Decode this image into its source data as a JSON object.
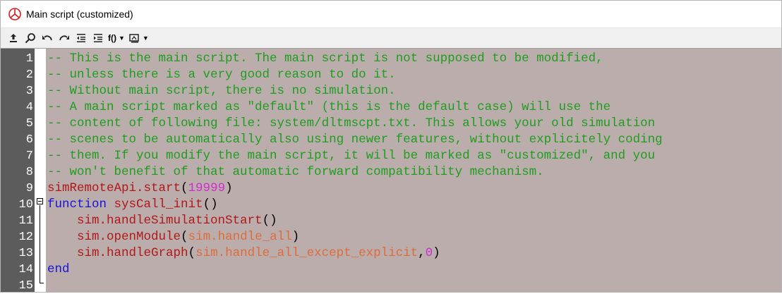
{
  "window": {
    "title": "Main script (customized)"
  },
  "toolbar": {
    "func_label": "f()"
  },
  "colors": {
    "editor_bg": "#bcadad",
    "gutter_bg": "#5c5c5c",
    "comment": "#1f9d1f",
    "function": "#b01818",
    "keyword": "#1515d6",
    "number": "#d12bd1",
    "constant": "#de6b3a"
  },
  "editor": {
    "line_numbers": [
      "1",
      "2",
      "3",
      "4",
      "5",
      "6",
      "7",
      "8",
      "9",
      "10",
      "11",
      "12",
      "13",
      "14",
      "15"
    ],
    "lines": [
      [
        {
          "t": "comment",
          "v": "-- This is the main script. The main script is not supposed to be modified,"
        }
      ],
      [
        {
          "t": "comment",
          "v": "-- unless there is a very good reason to do it."
        }
      ],
      [
        {
          "t": "comment",
          "v": "-- Without main script, there is no simulation."
        }
      ],
      [
        {
          "t": "comment",
          "v": "-- A main script marked as \"default\" (this is the default case) will use the"
        }
      ],
      [
        {
          "t": "comment",
          "v": "-- content of following file: system/dltmscpt.txt. This allows your old simulation"
        }
      ],
      [
        {
          "t": "comment",
          "v": "-- scenes to be automatically also using newer features, without explicitely coding"
        }
      ],
      [
        {
          "t": "comment",
          "v": "-- them. If you modify the main script, it will be marked as \"customized\", and you"
        }
      ],
      [
        {
          "t": "comment",
          "v": "-- won't benefit of that automatic forward compatibility mechanism."
        }
      ],
      [
        {
          "t": "func",
          "v": "simRemoteApi.start"
        },
        {
          "t": "plain",
          "v": "("
        },
        {
          "t": "num",
          "v": "19999"
        },
        {
          "t": "plain",
          "v": ")"
        }
      ],
      [
        {
          "t": "kw",
          "v": "function"
        },
        {
          "t": "plain",
          "v": " "
        },
        {
          "t": "func",
          "v": "sysCall_init"
        },
        {
          "t": "plain",
          "v": "()"
        }
      ],
      [
        {
          "t": "plain",
          "v": "    "
        },
        {
          "t": "func",
          "v": "sim.handleSimulationStart"
        },
        {
          "t": "plain",
          "v": "()"
        }
      ],
      [
        {
          "t": "plain",
          "v": "    "
        },
        {
          "t": "func",
          "v": "sim.openModule"
        },
        {
          "t": "plain",
          "v": "("
        },
        {
          "t": "const",
          "v": "sim.handle_all"
        },
        {
          "t": "plain",
          "v": ")"
        }
      ],
      [
        {
          "t": "plain",
          "v": "    "
        },
        {
          "t": "func",
          "v": "sim.handleGraph"
        },
        {
          "t": "plain",
          "v": "("
        },
        {
          "t": "const",
          "v": "sim.handle_all_except_explicit"
        },
        {
          "t": "plain",
          "v": ","
        },
        {
          "t": "num",
          "v": "0"
        },
        {
          "t": "plain",
          "v": ")"
        }
      ],
      [
        {
          "t": "kw",
          "v": "end"
        }
      ],
      []
    ]
  }
}
